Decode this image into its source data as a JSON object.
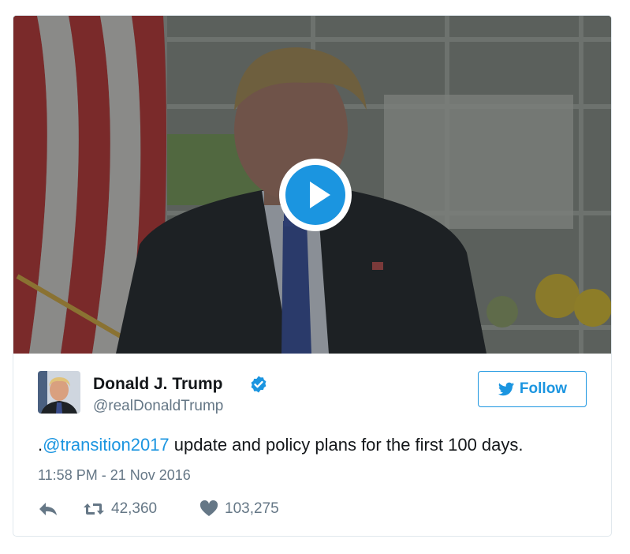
{
  "tweet": {
    "video": {
      "play_icon": "play-icon"
    },
    "author": {
      "name": "Donald J. Trump",
      "handle": "@realDonaldTrump",
      "verified_icon": "verified-badge-icon",
      "avatar": "avatar"
    },
    "follow_button": {
      "label": "Follow",
      "icon": "twitter-bird-icon"
    },
    "text": {
      "prefix": ".",
      "mention": "@transition2017",
      "rest": " update and policy plans for the first 100 days."
    },
    "timestamp": "11:58 PM - 21 Nov 2016",
    "actions": {
      "reply_icon": "reply-icon",
      "retweet_icon": "retweet-icon",
      "retweet_count": "42,360",
      "like_icon": "heart-icon",
      "like_count": "103,275"
    },
    "colors": {
      "accent": "#1b95e0",
      "text": "#14171a",
      "muted": "#657786",
      "border": "#e1e8ed"
    }
  }
}
